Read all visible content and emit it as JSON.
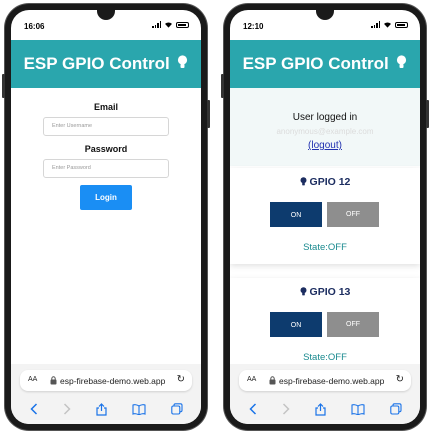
{
  "left_phone": {
    "time": "16:06",
    "header_title": "ESP GPIO Control",
    "email_label": "Email",
    "email_placeholder": "Enter Username",
    "password_label": "Password",
    "password_placeholder": "Enter Password",
    "login_label": "Login",
    "browser": {
      "aa": "AA",
      "url": "esp-firebase-demo.web.app"
    }
  },
  "right_phone": {
    "time": "12:10",
    "header_title": "ESP GPIO Control",
    "logged_text": "User logged in",
    "email_text": "anonymous@example.com",
    "logout_label": "(logout)",
    "gpio": [
      {
        "title": "GPIO 12",
        "on_label": "ON",
        "off_label": "OFF",
        "state": "State:OFF"
      },
      {
        "title": "GPIO 13",
        "on_label": "ON",
        "off_label": "OFF",
        "state": "State:OFF"
      }
    ],
    "browser": {
      "aa": "AA",
      "url": "esp-firebase-demo.web.app"
    }
  },
  "colors": {
    "header": "#2aa6ad",
    "login_button": "#1a8ef4",
    "on_button": "#0d3b6e",
    "off_button": "#8e8e8e",
    "state_text": "#1a8a8f"
  },
  "icons": [
    "lightbulb-icon",
    "lock-icon",
    "reload-icon",
    "back-icon",
    "forward-icon",
    "share-icon",
    "bookmarks-icon",
    "tabs-icon",
    "signal-icon",
    "wifi-icon",
    "battery-icon"
  ]
}
